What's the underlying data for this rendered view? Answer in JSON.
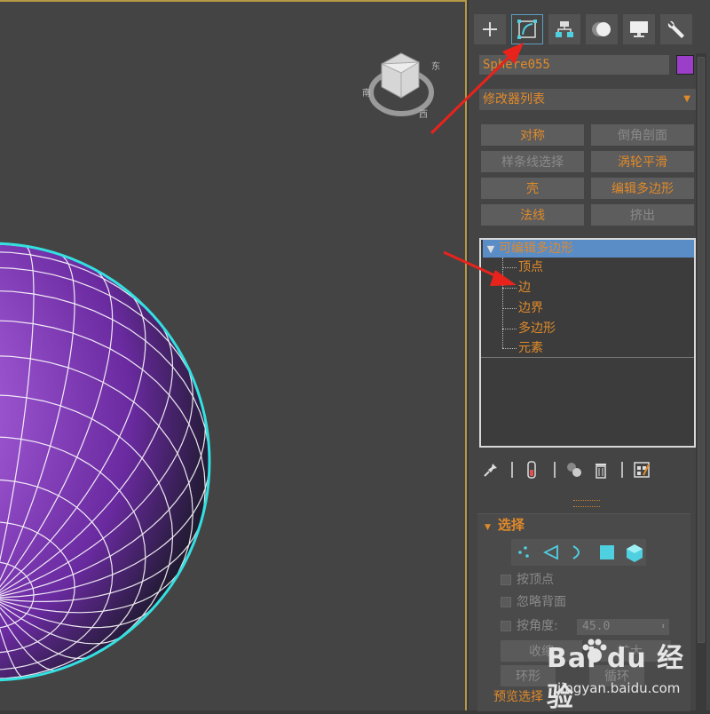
{
  "viewport": {
    "sphere_color": "#8a3cc0",
    "wire_color": "#ffffff",
    "selection_outline": "#33e0e0",
    "viewcube_icon": "viewcube-icon"
  },
  "command_panel": {
    "tabs": [
      {
        "name": "create",
        "icon": "plus-icon"
      },
      {
        "name": "modify",
        "icon": "modify-curve-icon",
        "active": true
      },
      {
        "name": "hierarchy",
        "icon": "hierarchy-icon"
      },
      {
        "name": "motion",
        "icon": "motion-icon"
      },
      {
        "name": "display",
        "icon": "monitor-icon"
      },
      {
        "name": "utilities",
        "icon": "wrench-icon"
      }
    ],
    "object_name": "Sphere055",
    "object_color": "#9b3fc8",
    "modifier_list": "修改器列表",
    "modifier_buttons": [
      {
        "label": "对称",
        "enabled": true
      },
      {
        "label": "倒角剖面",
        "enabled": false
      },
      {
        "label": "样条线选择",
        "enabled": false
      },
      {
        "label": "涡轮平滑",
        "enabled": true
      },
      {
        "label": "壳",
        "enabled": true
      },
      {
        "label": "编辑多边形",
        "enabled": true
      },
      {
        "label": "法线",
        "enabled": true
      },
      {
        "label": "挤出",
        "enabled": false
      }
    ],
    "stack": {
      "root": "可编辑多边形",
      "sub_objects": [
        "顶点",
        "边",
        "边界",
        "多边形",
        "元素"
      ]
    },
    "selection_rollout": {
      "title": "选择",
      "by_vertex": "按顶点",
      "ignore_backfacing": "忽略背面",
      "by_angle": "按角度:",
      "angle_value": "45.0",
      "shrink": "收缩",
      "grow": "扩大",
      "ring": "环形",
      "loop": "循环",
      "preview_selection": "预览选择"
    }
  },
  "watermark": {
    "brand": "Bai du 经验",
    "url": "jingyan.baidu.com"
  },
  "colors": {
    "accent_orange": "#e08a2a",
    "arrow_red": "#e8231c",
    "highlight_blue": "#5a8cc6"
  }
}
